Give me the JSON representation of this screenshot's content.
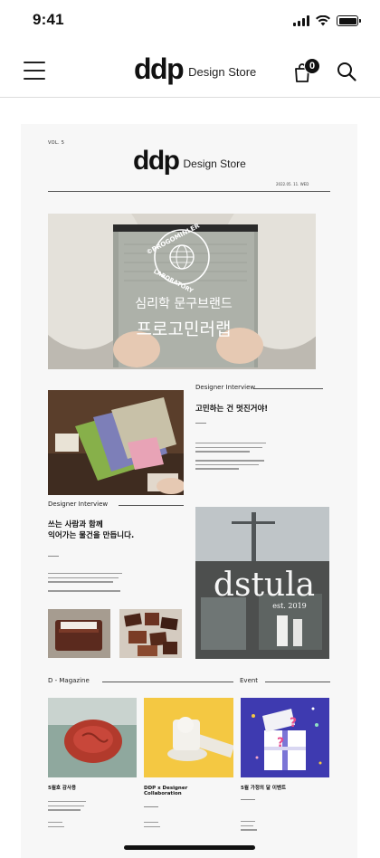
{
  "status_bar": {
    "time": "9:41"
  },
  "header": {
    "brand_mark": "ddp",
    "brand_name": "Design Store",
    "cart_count": "0",
    "icons": {
      "menu": "hamburger-menu-icon",
      "cart": "shopping-bag-icon",
      "search": "search-icon"
    }
  },
  "magazine": {
    "volume": "VOL. 5",
    "brand_mark": "ddp",
    "brand_name": "Design Store",
    "date": "2022.05. 11. WED",
    "hero": {
      "stamp_top": "©PROGOMINLER",
      "stamp_bottom": "LABORATORY",
      "title_line1": "심리학 문구브랜드",
      "title_line2": "프로고민러랩"
    },
    "interview1": {
      "section": "Designer Interview",
      "headline": "고민하는 건 멋진거야!"
    },
    "interview2": {
      "section": "Designer Interview",
      "headline_line1": "쓰는 사람과 함께",
      "headline_line2": "익어가는 물건을 만듭니다.",
      "shop_name": "dstula",
      "shop_est": "est. 2019"
    },
    "d_magazine": {
      "section": "D - Magazine"
    },
    "event": {
      "section": "Event"
    },
    "cards": [
      {
        "caption": "5월호 감사용"
      },
      {
        "caption_line1": "DDP x Designer",
        "caption_line2": "Collaboration"
      },
      {
        "caption": "5월 가정의 달 이벤트"
      }
    ]
  },
  "colors": {
    "accent": "#111111",
    "event_bg": "#3e3ab0",
    "card2_bg": "#f4c842",
    "wax_seal": "#b23a2c"
  }
}
